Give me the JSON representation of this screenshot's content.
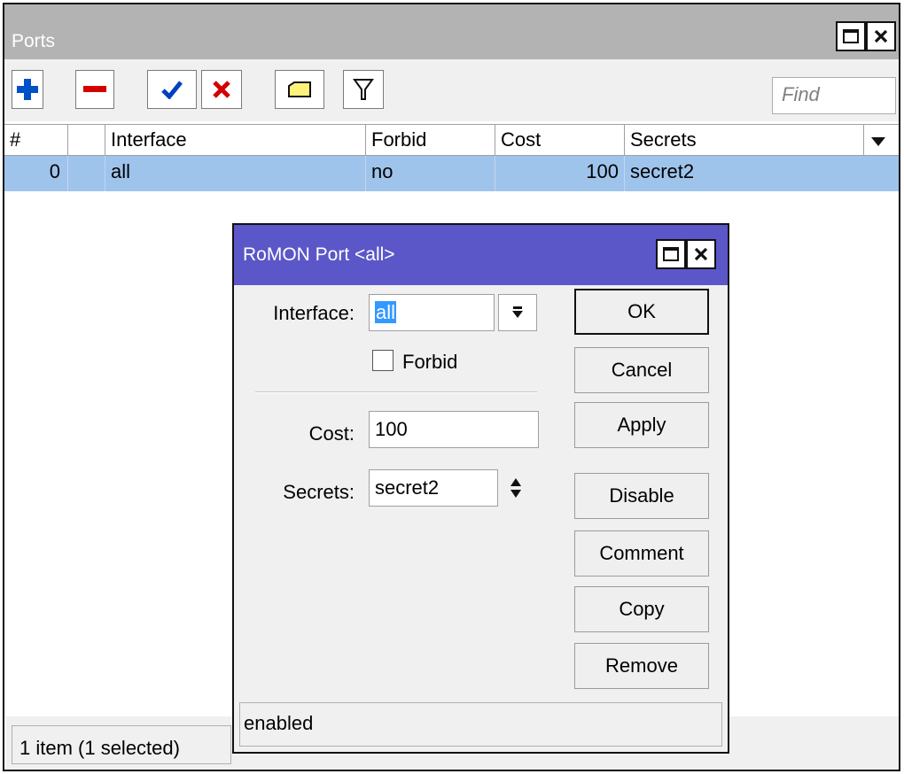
{
  "ports_window": {
    "title": "Ports",
    "find_placeholder": "Find",
    "columns": [
      "#",
      "",
      "Interface",
      "Forbid",
      "Cost",
      "Secrets"
    ],
    "rows": [
      {
        "num": "0",
        "flag": "",
        "interface": "all",
        "forbid": "no",
        "cost": "100",
        "secrets": "secret2",
        "selected": true
      }
    ],
    "status": "1 item (1 selected)"
  },
  "toolbar": {
    "icons": [
      "add-icon",
      "remove-icon",
      "enable-icon",
      "disable-icon",
      "comment-icon",
      "filter-icon"
    ]
  },
  "dialog": {
    "title": "RoMON Port <all>",
    "interface_label": "Interface:",
    "interface_value": "all",
    "forbid_label": "Forbid",
    "forbid_checked": false,
    "cost_label": "Cost:",
    "cost_value": "100",
    "secrets_label": "Secrets:",
    "secrets_value": "secret2",
    "buttons": {
      "ok": "OK",
      "cancel": "Cancel",
      "apply": "Apply",
      "disable": "Disable",
      "comment": "Comment",
      "copy": "Copy",
      "remove": "Remove"
    },
    "status": "enabled"
  },
  "colors": {
    "title_inactive": "#b3b3b3",
    "title_active": "#5b57c8",
    "row_selected": "#9fc4ec",
    "add_icon": "#0050c8",
    "remove_icon": "#d40000"
  }
}
